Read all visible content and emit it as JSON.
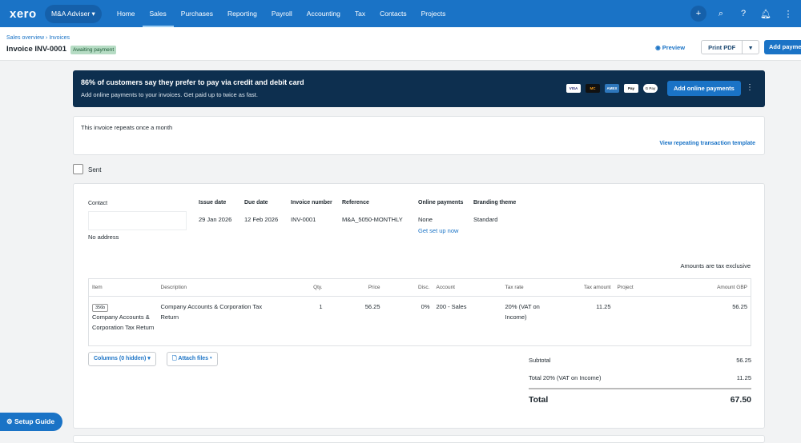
{
  "nav": {
    "logo": "xero",
    "org": "M&A Adviser ▾",
    "items": [
      "Home",
      "Sales",
      "Purchases",
      "Reporting",
      "Payroll",
      "Accounting",
      "Tax",
      "Contacts",
      "Projects"
    ]
  },
  "header": {
    "breadcrumb": [
      "Sales overview",
      "Invoices"
    ],
    "title": "Invoice INV-0001",
    "status": "Awaiting payment",
    "preview": "Preview",
    "print_pdf": "Print PDF",
    "add_payment": "Add payment"
  },
  "banner": {
    "headline": "86% of customers say they prefer to pay via credit and debit card",
    "subtext": "Add online payments to your invoices. Get paid up to twice as fast.",
    "cards": [
      "VISA",
      "MC",
      "AMEX",
      "Pay",
      "G Pay"
    ],
    "button": "Add online payments"
  },
  "repeat": {
    "text": "This invoice repeats once a month",
    "link": "View repeating transaction template"
  },
  "sent": {
    "label": "Sent",
    "checked": false
  },
  "invoice": {
    "contact_label": "Contact",
    "contact_value": "",
    "address": "No address",
    "fields": [
      {
        "label": "Issue date",
        "value": "29 Jan 2026"
      },
      {
        "label": "Due date",
        "value": "12 Feb 2026"
      },
      {
        "label": "Invoice number",
        "value": "INV-0001"
      },
      {
        "label": "Reference",
        "value": "M&A_5050-MONTHLY"
      },
      {
        "label": "Online payments",
        "value": "None"
      },
      {
        "label": "Branding theme",
        "value": "Standard"
      }
    ],
    "setup_link": "Get set up now",
    "tax_note": "Amounts are tax exclusive",
    "columns": [
      "Item",
      "Description",
      "Qty.",
      "Price",
      "Disc.",
      "Account",
      "Tax rate",
      "Tax amount",
      "Project",
      "Amount GBP"
    ],
    "rows": [
      {
        "code": "356b",
        "item": "Company Accounts & Corporation Tax Return",
        "description": "Company Accounts & Corporation Tax Return",
        "qty": "1",
        "price": "56.25",
        "disc": "0%",
        "account": "200 - Sales",
        "tax_rate": "20% (VAT on Income)",
        "tax_amount": "11.25",
        "project": "",
        "amount": "56.25"
      }
    ],
    "columns_btn": "Columns (0 hidden)",
    "attach_btn": "Attach files",
    "subtotal_label": "Subtotal",
    "subtotal": "56.25",
    "tax_label": "Total 20% (VAT on Income)",
    "tax": "11.25",
    "total_label": "Total",
    "total": "67.50"
  },
  "setup_guide": "Setup Guide"
}
